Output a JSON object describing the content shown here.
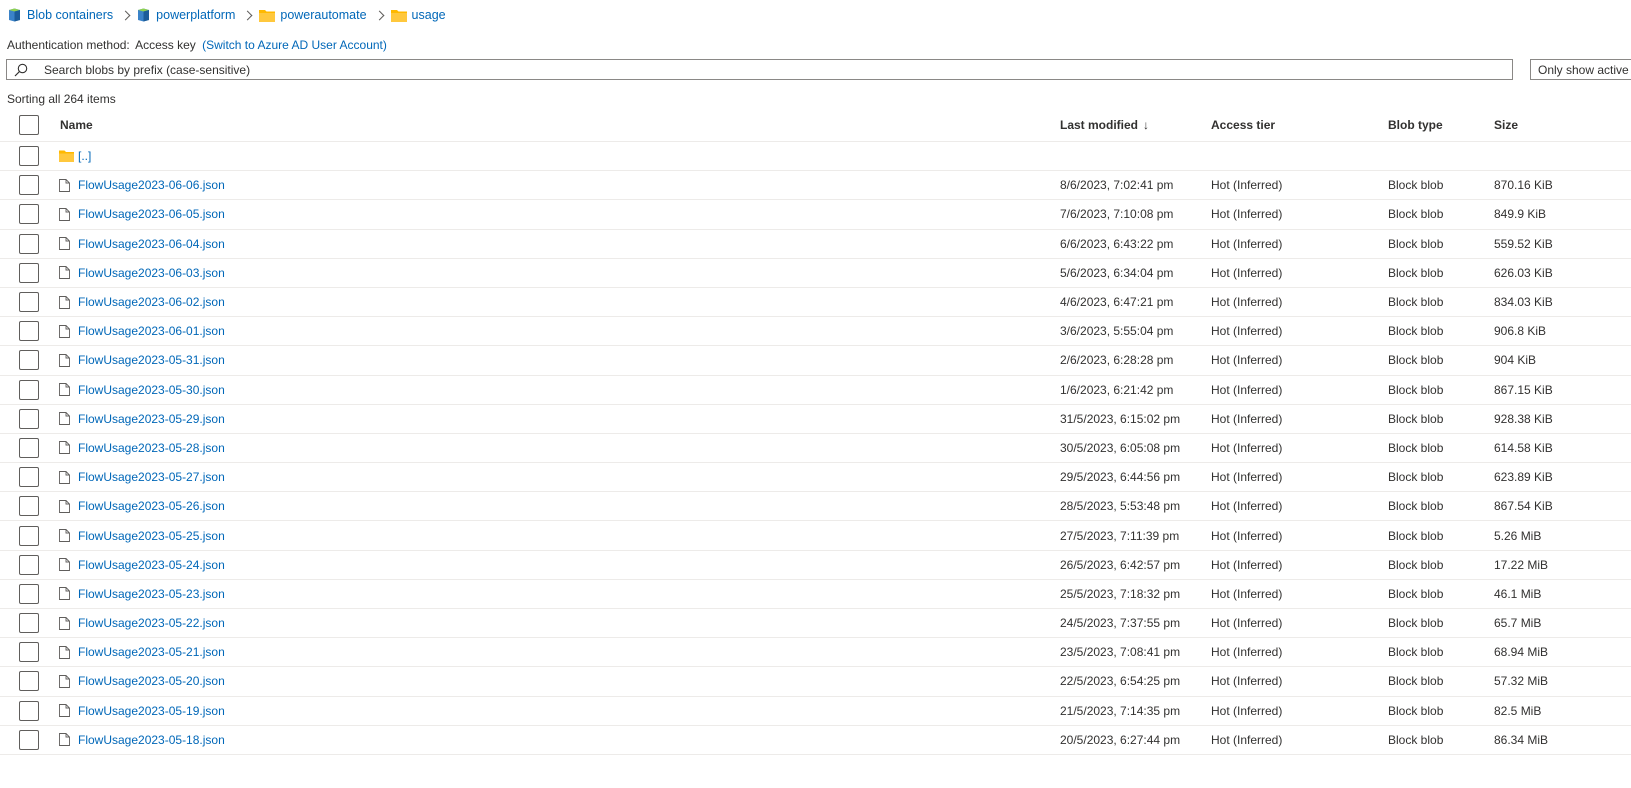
{
  "breadcrumb": {
    "items": [
      {
        "label": "Blob containers",
        "icon": "storage-container-icon"
      },
      {
        "label": "powerplatform",
        "icon": "storage-container-icon"
      },
      {
        "label": "powerautomate",
        "icon": "folder-icon"
      },
      {
        "label": "usage",
        "icon": "folder-icon"
      }
    ]
  },
  "auth": {
    "label": "Authentication method:",
    "value": "Access key",
    "switch_link": "(Switch to Azure AD User Account)"
  },
  "search": {
    "placeholder": "Search blobs by prefix (case-sensitive)",
    "value": ""
  },
  "only_button": {
    "label": "Only show active blobs"
  },
  "sort_info": "Sorting all 264 items",
  "table": {
    "headers": {
      "name": "Name",
      "last_modified": "Last modified",
      "sort_indicator": "↓",
      "access_tier": "Access tier",
      "blob_type": "Blob type",
      "size": "Size"
    },
    "parent_row": {
      "label": "[..]"
    },
    "rows": [
      {
        "name": "FlowUsage2023-06-06.json",
        "modified": "8/6/2023, 7:02:41 pm",
        "tier": "Hot (Inferred)",
        "type": "Block blob",
        "size": "870.16 KiB"
      },
      {
        "name": "FlowUsage2023-06-05.json",
        "modified": "7/6/2023, 7:10:08 pm",
        "tier": "Hot (Inferred)",
        "type": "Block blob",
        "size": "849.9 KiB"
      },
      {
        "name": "FlowUsage2023-06-04.json",
        "modified": "6/6/2023, 6:43:22 pm",
        "tier": "Hot (Inferred)",
        "type": "Block blob",
        "size": "559.52 KiB"
      },
      {
        "name": "FlowUsage2023-06-03.json",
        "modified": "5/6/2023, 6:34:04 pm",
        "tier": "Hot (Inferred)",
        "type": "Block blob",
        "size": "626.03 KiB"
      },
      {
        "name": "FlowUsage2023-06-02.json",
        "modified": "4/6/2023, 6:47:21 pm",
        "tier": "Hot (Inferred)",
        "type": "Block blob",
        "size": "834.03 KiB"
      },
      {
        "name": "FlowUsage2023-06-01.json",
        "modified": "3/6/2023, 5:55:04 pm",
        "tier": "Hot (Inferred)",
        "type": "Block blob",
        "size": "906.8 KiB"
      },
      {
        "name": "FlowUsage2023-05-31.json",
        "modified": "2/6/2023, 6:28:28 pm",
        "tier": "Hot (Inferred)",
        "type": "Block blob",
        "size": "904 KiB"
      },
      {
        "name": "FlowUsage2023-05-30.json",
        "modified": "1/6/2023, 6:21:42 pm",
        "tier": "Hot (Inferred)",
        "type": "Block blob",
        "size": "867.15 KiB"
      },
      {
        "name": "FlowUsage2023-05-29.json",
        "modified": "31/5/2023, 6:15:02 pm",
        "tier": "Hot (Inferred)",
        "type": "Block blob",
        "size": "928.38 KiB"
      },
      {
        "name": "FlowUsage2023-05-28.json",
        "modified": "30/5/2023, 6:05:08 pm",
        "tier": "Hot (Inferred)",
        "type": "Block blob",
        "size": "614.58 KiB"
      },
      {
        "name": "FlowUsage2023-05-27.json",
        "modified": "29/5/2023, 6:44:56 pm",
        "tier": "Hot (Inferred)",
        "type": "Block blob",
        "size": "623.89 KiB"
      },
      {
        "name": "FlowUsage2023-05-26.json",
        "modified": "28/5/2023, 5:53:48 pm",
        "tier": "Hot (Inferred)",
        "type": "Block blob",
        "size": "867.54 KiB"
      },
      {
        "name": "FlowUsage2023-05-25.json",
        "modified": "27/5/2023, 7:11:39 pm",
        "tier": "Hot (Inferred)",
        "type": "Block blob",
        "size": "5.26 MiB"
      },
      {
        "name": "FlowUsage2023-05-24.json",
        "modified": "26/5/2023, 6:42:57 pm",
        "tier": "Hot (Inferred)",
        "type": "Block blob",
        "size": "17.22 MiB"
      },
      {
        "name": "FlowUsage2023-05-23.json",
        "modified": "25/5/2023, 7:18:32 pm",
        "tier": "Hot (Inferred)",
        "type": "Block blob",
        "size": "46.1 MiB"
      },
      {
        "name": "FlowUsage2023-05-22.json",
        "modified": "24/5/2023, 7:37:55 pm",
        "tier": "Hot (Inferred)",
        "type": "Block blob",
        "size": "65.7 MiB"
      },
      {
        "name": "FlowUsage2023-05-21.json",
        "modified": "23/5/2023, 7:08:41 pm",
        "tier": "Hot (Inferred)",
        "type": "Block blob",
        "size": "68.94 MiB"
      },
      {
        "name": "FlowUsage2023-05-20.json",
        "modified": "22/5/2023, 6:54:25 pm",
        "tier": "Hot (Inferred)",
        "type": "Block blob",
        "size": "57.32 MiB"
      },
      {
        "name": "FlowUsage2023-05-19.json",
        "modified": "21/5/2023, 7:14:35 pm",
        "tier": "Hot (Inferred)",
        "type": "Block blob",
        "size": "82.5 MiB"
      },
      {
        "name": "FlowUsage2023-05-18.json",
        "modified": "20/5/2023, 6:27:44 pm",
        "tier": "Hot (Inferred)",
        "type": "Block blob",
        "size": "86.34 MiB"
      }
    ]
  },
  "colors": {
    "link": "#0067b8",
    "text": "#323130",
    "folder": "#ffb900",
    "border": "#8a8886",
    "divider": "#edebe9"
  }
}
